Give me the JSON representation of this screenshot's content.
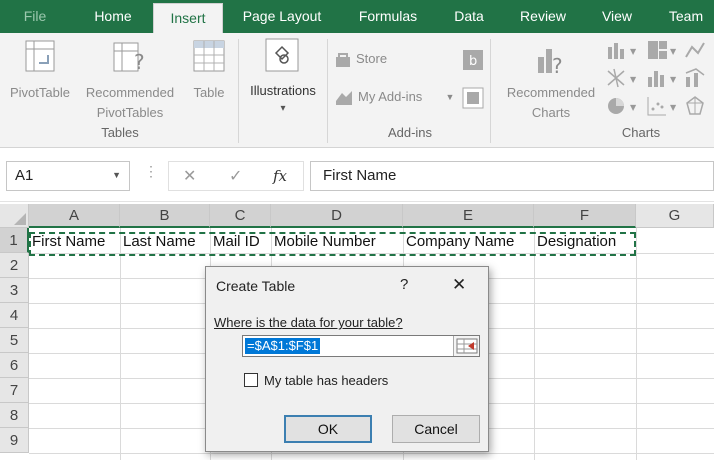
{
  "tabs": [
    "File",
    "Home",
    "Insert",
    "Page Layout",
    "Formulas",
    "Data",
    "Review",
    "View",
    "Team"
  ],
  "active_tab": "Insert",
  "ribbon": {
    "tables": {
      "pivottable": "PivotTable",
      "recommended_pivottables_1": "Recommended",
      "recommended_pivottables_2": "PivotTables",
      "table": "Table",
      "group_label": "Tables"
    },
    "illustrations": {
      "label": "Illustrations",
      "arrow": "▾"
    },
    "addins": {
      "store": "Store",
      "my_addins": "My Add-ins",
      "group_label": "Add-ins"
    },
    "charts": {
      "recommended_1": "Recommended",
      "recommended_2": "Charts",
      "group_label": "Charts"
    }
  },
  "formula_bar": {
    "name_box": "A1",
    "cancel_icon": "✕",
    "enter_icon": "✓",
    "fx": "fx",
    "value": "First Name"
  },
  "sheet": {
    "columns": [
      "A",
      "B",
      "C",
      "D",
      "E",
      "F",
      "G"
    ],
    "rows": [
      "1",
      "2",
      "3",
      "4",
      "5",
      "6",
      "7",
      "8",
      "9"
    ],
    "row1": [
      "First Name",
      "Last Name",
      "Mail ID",
      "Mobile Number",
      "Company Name",
      "Designation"
    ]
  },
  "dialog": {
    "title": "Create Table",
    "help": "?",
    "close": "✕",
    "prompt": "Where is the data for your table?",
    "range_value": "=$A$1:$F$1",
    "checkbox_label": "My table has headers",
    "checkbox_checked": false,
    "ok": "OK",
    "cancel": "Cancel"
  },
  "colors": {
    "excel_green": "#217346",
    "ribbon_bg": "#f3f3f3"
  }
}
